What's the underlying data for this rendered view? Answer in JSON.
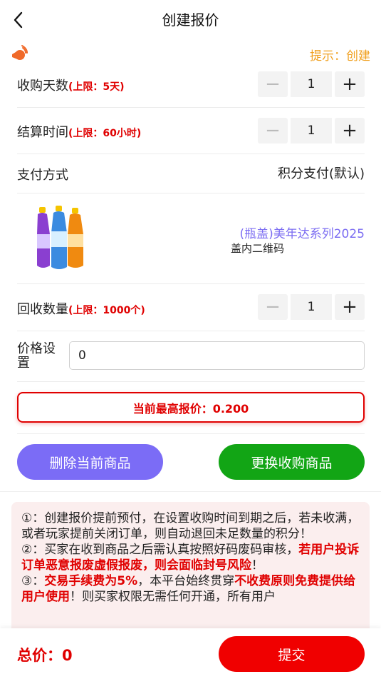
{
  "header": {
    "title": "创建报价",
    "back_icon": "back-chevron-icon"
  },
  "notice": {
    "icon": "horn-icon",
    "text": "提示：创建"
  },
  "collect_days": {
    "label": "收购天数",
    "limit": "(上限：5天)",
    "value": "1"
  },
  "settle_time": {
    "label": "结算时间",
    "limit": "(上限：60小时)",
    "value": "1"
  },
  "payment": {
    "label": "支付方式",
    "value": "积分支付(默认)"
  },
  "product": {
    "name": "(瓶盖)美年达系列2025",
    "sub": "盖内二维码"
  },
  "recycle_qty": {
    "label": "回收数量",
    "limit": "(上限：1000个)",
    "value": "1"
  },
  "price": {
    "label": "价格设置",
    "value": "0"
  },
  "highest_offer": {
    "text": "当前最高报价：0.200"
  },
  "buttons": {
    "delete": "删除当前商品",
    "replace": "更换收购商品",
    "submit": "提交"
  },
  "colors": {
    "accent_red": "#e00000",
    "purple": "#7b6cf6",
    "green": "#12a515",
    "notice_orange": "#f0a020"
  },
  "info": {
    "p1": "①：创建报价提前预付，在设置收购时间到期之后，若未收满，或者玩家提前关闭订单，则自动退回未足数量的积分！",
    "p2_a": "②：买家在收到商品之后需认真按照好码废码审核，",
    "p2_b": "若用户投诉订单恶意报废虚假报废，则会面临封号风险",
    "p2_c": "！",
    "p3_a": "③：",
    "p3_b": "交易手续费为5%",
    "p3_c": "，本平台始终贯穿",
    "p3_d": "不收费原则免费提供给用户使用",
    "p3_e": "！则买家权限无需任何开通，所有用户"
  },
  "footer": {
    "total": "总价：0"
  }
}
